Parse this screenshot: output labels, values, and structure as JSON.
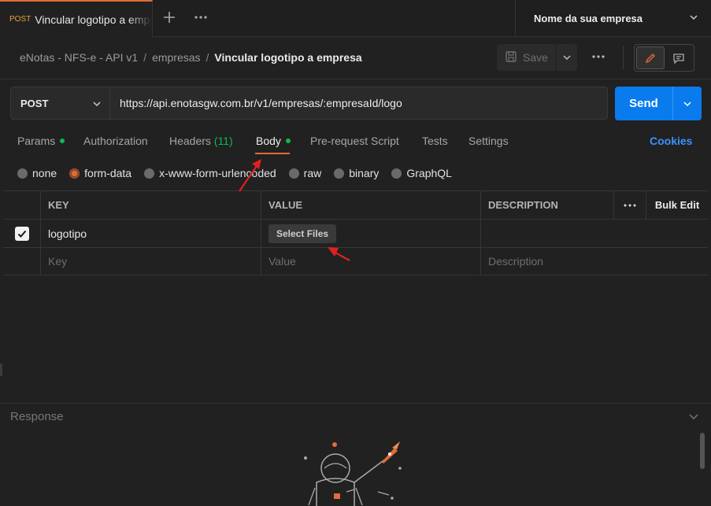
{
  "tabs": {
    "active": {
      "method": "POST",
      "title": "Vincular logotipo a empresa"
    },
    "new_tab_icon": "plus-icon",
    "more_icon": "more-horizontal-icon"
  },
  "environment": {
    "label": "Nome da sua empresa"
  },
  "breadcrumb": {
    "items": [
      "eNotas - NFS-e - API v1",
      "empresas"
    ],
    "separator": "/",
    "current": "Vincular logotipo a empresa"
  },
  "toolbar": {
    "save_label": "Save",
    "more_label": "•••"
  },
  "request": {
    "method": "POST",
    "url": "https://api.enotasgw.com.br/v1/empresas/:empresaId/logo",
    "send_label": "Send"
  },
  "request_tabs": {
    "params": "Params",
    "authorization": "Authorization",
    "headers": "Headers",
    "headers_count": "(11)",
    "body": "Body",
    "prerequest": "Pre-request Script",
    "tests": "Tests",
    "settings": "Settings",
    "cookies": "Cookies"
  },
  "body_types": {
    "selected": "form-data",
    "options": [
      "none",
      "form-data",
      "x-www-form-urlencoded",
      "raw",
      "binary",
      "GraphQL"
    ]
  },
  "form_table": {
    "headers": {
      "key": "KEY",
      "value": "VALUE",
      "description": "DESCRIPTION",
      "more": "•••",
      "bulk_edit": "Bulk Edit"
    },
    "rows": [
      {
        "checked": true,
        "key": "logotipo",
        "value_button": "Select Files",
        "description": ""
      }
    ],
    "placeholders": {
      "key": "Key",
      "value": "Value",
      "description": "Description"
    }
  },
  "response": {
    "title": "Response"
  },
  "colors": {
    "accent": "#e46b37",
    "send": "#097bed",
    "green": "#0cbb52",
    "link": "#3a93ff",
    "annotation": "#e02020"
  }
}
